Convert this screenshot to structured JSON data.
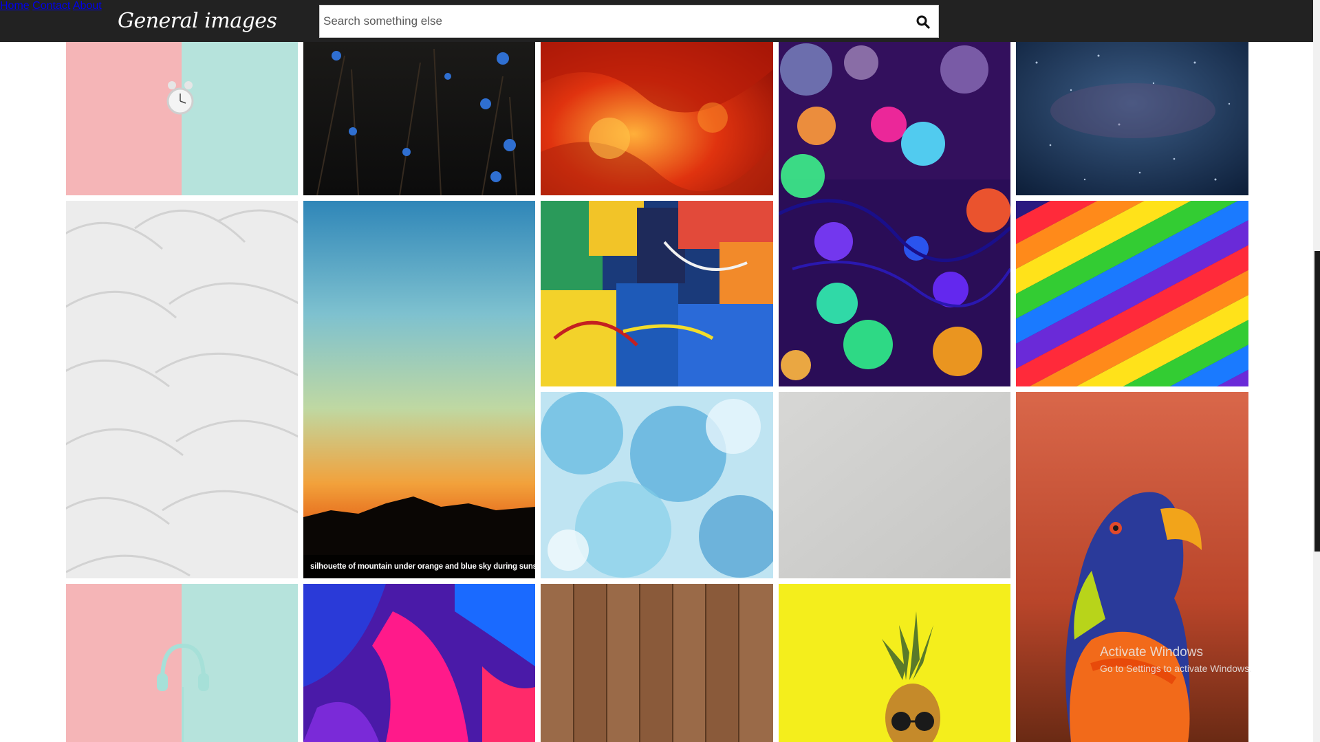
{
  "header": {
    "brand": "General images",
    "search_placeholder": "Search something else",
    "search_icon": "search-icon",
    "nav": [
      {
        "label": "Home"
      },
      {
        "label": "Contact"
      },
      {
        "label": "About"
      }
    ]
  },
  "gallery": {
    "tiles": [
      {
        "subject": "alarm clock on pink and mint background"
      },
      {
        "subject": "blue flowers in the dark"
      },
      {
        "subject": "red and orange nebula"
      },
      {
        "subject": "colorful bokeh string lights"
      },
      {
        "subject": "blue starry galaxy"
      },
      {
        "subject": "white textured plaster wall"
      },
      {
        "subject": "sunset gradient sky over mountains",
        "caption": "silhouette of mountain under orange and blue sky during sunset"
      },
      {
        "subject": "colorful abstract paint strokes"
      },
      {
        "subject": "rainbow glossy paint stripes"
      },
      {
        "subject": "blue watercolor texture"
      },
      {
        "subject": "plain light gray wall"
      },
      {
        "subject": "rainbow lorikeet parrot"
      },
      {
        "subject": "headphones on pink and mint background"
      },
      {
        "subject": "pink and blue acrylic paint"
      },
      {
        "subject": "wooden planks texture"
      },
      {
        "subject": "pineapple with sunglasses on yellow background"
      }
    ]
  },
  "system_overlay": {
    "title": "Activate Windows",
    "subtitle": "Go to Settings to activate Windows."
  },
  "colors": {
    "topbar": "#222222",
    "text_light": "#ffffff"
  }
}
